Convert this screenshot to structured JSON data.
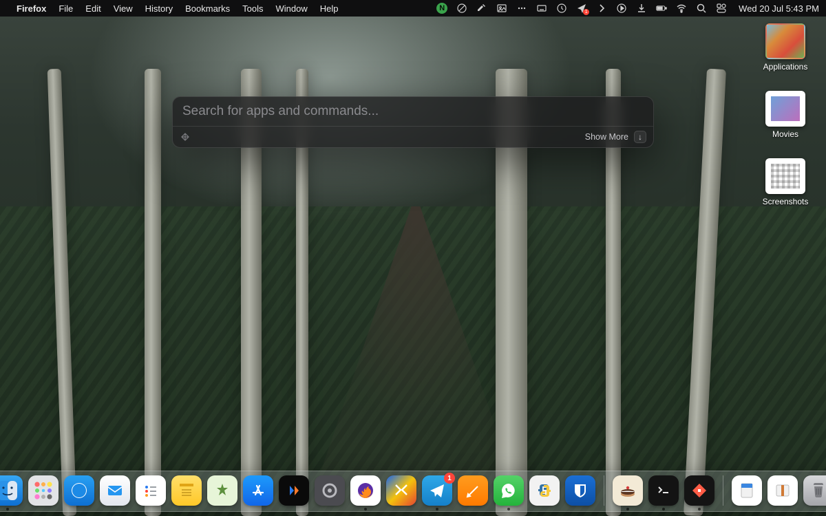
{
  "menubar": {
    "app": "Firefox",
    "items": [
      "File",
      "Edit",
      "View",
      "History",
      "Bookmarks",
      "Tools",
      "Window",
      "Help"
    ],
    "n_badge": "N",
    "location_badge": "1",
    "clock": "Wed 20 Jul  5:43 PM"
  },
  "palette": {
    "placeholder": "Search for apps and commands...",
    "value": "",
    "show_more_label": "Show More",
    "shortcut_glyph": "↓"
  },
  "desktop": {
    "items": [
      {
        "label": "Applications"
      },
      {
        "label": "Movies"
      },
      {
        "label": "Screenshots"
      }
    ]
  },
  "dock": {
    "telegram_badge": "1",
    "apps": [
      {
        "name": "finder",
        "running": true
      },
      {
        "name": "launchpad",
        "running": false
      },
      {
        "name": "safari",
        "running": false
      },
      {
        "name": "mail",
        "running": false
      },
      {
        "name": "reminders",
        "running": false
      },
      {
        "name": "notes",
        "running": false
      },
      {
        "name": "opencv",
        "running": false
      },
      {
        "name": "appstore",
        "running": false
      },
      {
        "name": "media",
        "running": false
      },
      {
        "name": "settings",
        "running": false
      },
      {
        "name": "firefox",
        "running": true
      },
      {
        "name": "warp",
        "running": false
      },
      {
        "name": "telegram",
        "running": true
      },
      {
        "name": "pages",
        "running": false
      },
      {
        "name": "whatsapp",
        "running": true
      },
      {
        "name": "pycharm",
        "running": false
      },
      {
        "name": "bitwarden",
        "running": false
      }
    ],
    "extras": [
      {
        "name": "cake",
        "running": true
      },
      {
        "name": "terminal",
        "running": true
      },
      {
        "name": "raycast-app",
        "running": true
      }
    ],
    "right": [
      {
        "name": "doc1"
      },
      {
        "name": "doc2"
      },
      {
        "name": "trash"
      }
    ]
  }
}
